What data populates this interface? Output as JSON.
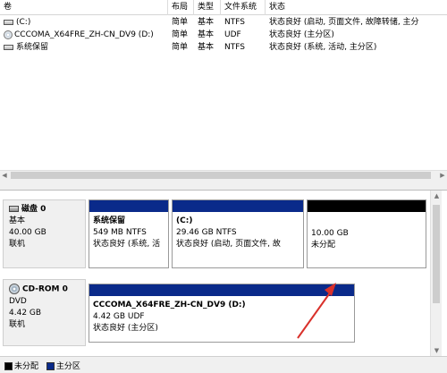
{
  "columns": [
    "卷",
    "布局",
    "类型",
    "文件系统",
    "状态"
  ],
  "volumes": [
    {
      "name": "(C:)",
      "layout": "简单",
      "type": "基本",
      "fs": "NTFS",
      "status": "状态良好 (启动, 页面文件, 故障转储, 主分",
      "icon": "drive-icon"
    },
    {
      "name": "CCCOMA_X64FRE_ZH-CN_DV9 (D:)",
      "layout": "简单",
      "type": "基本",
      "fs": "UDF",
      "status": "状态良好 (主分区)",
      "icon": "cd-icon"
    },
    {
      "name": "系统保留",
      "layout": "简单",
      "type": "基本",
      "fs": "NTFS",
      "status": "状态良好 (系统, 活动, 主分区)",
      "icon": "drive-icon"
    }
  ],
  "disks": [
    {
      "name": "磁盘 0",
      "kind": "基本",
      "size": "40.00 GB",
      "state": "联机",
      "partitions": [
        {
          "name": "系统保留",
          "detail": "549 MB NTFS",
          "status": "状态良好 (系统, 活",
          "stripe": "#0a2a8a"
        },
        {
          "name": "(C:)",
          "detail": "29.46 GB NTFS",
          "status": "状态良好 (启动, 页面文件, 故",
          "stripe": "#0a2a8a"
        },
        {
          "name": "",
          "detail": "10.00 GB",
          "status": "未分配",
          "stripe": "#000000"
        }
      ]
    },
    {
      "name": "CD-ROM 0",
      "kind": "DVD",
      "size": "4.42 GB",
      "state": "联机",
      "partitions": [
        {
          "name": "CCCOMA_X64FRE_ZH-CN_DV9  (D:)",
          "detail": "4.42 GB UDF",
          "status": "状态良好 (主分区)",
          "stripe": "#0a2a8a"
        }
      ]
    }
  ],
  "legend": [
    {
      "label": "未分配",
      "color": "#000000"
    },
    {
      "label": "主分区",
      "color": "#0a2a8a"
    }
  ],
  "annotation_color": "#d9312b"
}
